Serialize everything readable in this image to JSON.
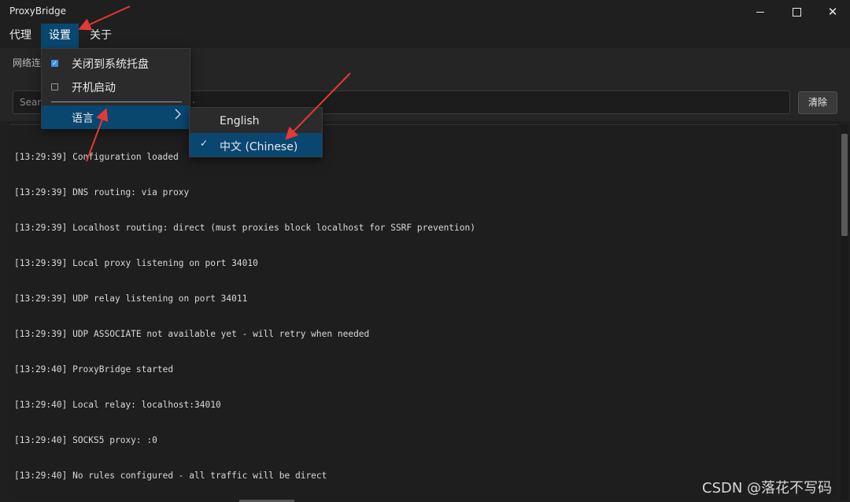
{
  "window": {
    "title": "ProxyBridge",
    "controls": {
      "minimize": "minimize-icon",
      "maximize": "maximize-icon",
      "close": "close-icon"
    }
  },
  "menubar": {
    "items": [
      {
        "label": "代理"
      },
      {
        "label": "设置",
        "active": true
      },
      {
        "label": "关于"
      }
    ]
  },
  "tabs": {
    "first_label_partial": "网络连"
  },
  "search": {
    "placeholder_partial": "Sear",
    "trailing_visible": "."
  },
  "clear_button": {
    "label": "清除"
  },
  "log": {
    "lines": [
      "[13:29:39] Configuration loaded",
      "[13:29:39] DNS routing: via proxy",
      "[13:29:39] Localhost routing: direct (must proxies block localhost for SSRF prevention)",
      "[13:29:39] Local proxy listening on port 34010",
      "[13:29:39] UDP relay listening on port 34011",
      "[13:29:39] UDP ASSOCIATE not available yet - will retry when needed",
      "[13:29:40] ProxyBridge started",
      "[13:29:40] Local relay: localhost:34010",
      "[13:29:40] SOCKS5 proxy: :0",
      "[13:29:40] No rules configured - all traffic will be direct"
    ]
  },
  "settings_menu": {
    "items": [
      {
        "label": "关闭到系统托盘",
        "checked": true
      },
      {
        "label": "开机启动",
        "checked": false
      },
      {
        "label": "语言",
        "has_submenu": true,
        "highlighted": true
      }
    ]
  },
  "language_submenu": {
    "items": [
      {
        "label": "English",
        "selected": false
      },
      {
        "label": "中文 (Chinese)",
        "selected": true
      }
    ]
  },
  "colors": {
    "background": "#1f1f1f",
    "highlight": "#094771",
    "annotation_arrow": "#e53935"
  },
  "watermark": "CSDN @落花不写码"
}
